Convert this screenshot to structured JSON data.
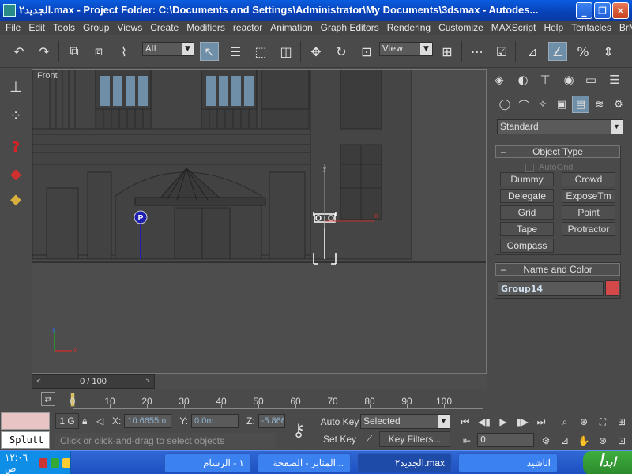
{
  "window": {
    "title": "الجديد٢.max    - Project Folder: C:\\Documents and Settings\\Administrator\\My Documents\\3dsmax    - Autodes...",
    "minimize": "_",
    "restore": "❐",
    "close": "✕"
  },
  "menubar": {
    "items": [
      "File",
      "Edit",
      "Tools",
      "Group",
      "Views",
      "Create",
      "Modifiers",
      "reactor",
      "Animation",
      "Graph Editors",
      "Rendering",
      "Customize",
      "MAXScript",
      "Help",
      "Tentacles",
      "BrMax"
    ]
  },
  "toolbar": {
    "selection_filter": "All",
    "ref_coord": "View"
  },
  "viewport": {
    "label": "Front",
    "axis_y": "y",
    "axis_x": "x",
    "axis_z": "z"
  },
  "timeslider": {
    "value": "0 / 100",
    "left_arrow": "<",
    "right_arrow": ">"
  },
  "trackbar": {
    "ticks": [
      "0",
      "10",
      "20",
      "30",
      "40",
      "50",
      "60",
      "70",
      "80",
      "90",
      "100"
    ],
    "current_frame": 0
  },
  "status": {
    "listener_text": "Splutt",
    "selection_count": "1 G",
    "x_label": "X:",
    "x_value": "10.6655m",
    "y_label": "Y:",
    "y_value": "0.0m",
    "z_label": "Z:",
    "z_value": "-5.866",
    "prompt": "Click or click-and-drag to select objects",
    "auto_key": "Auto Key",
    "set_key": "Set Key",
    "selected": "Selected",
    "key_filters": "Key Filters...",
    "frame": "0"
  },
  "command_panel": {
    "category": "Standard",
    "object_type_title": "Object Type",
    "autogrid": "AutoGrid",
    "buttons": [
      "Dummy",
      "Crowd",
      "Delegate",
      "ExposeTm",
      "Grid",
      "Point",
      "Tape",
      "Protractor",
      "Compass"
    ],
    "name_color_title": "Name and Color",
    "object_name": "Group14",
    "object_color": "#d34848"
  },
  "taskbar": {
    "start": "ابدأ",
    "clock": "١٢:٠٦ ص",
    "tasks": [
      "١ - الرسام",
      "المنابر - الصفحة...",
      "الجديد٢.max",
      "اناشيد"
    ]
  }
}
